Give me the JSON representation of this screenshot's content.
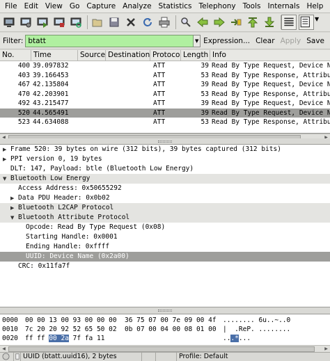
{
  "menubar": [
    "File",
    "Edit",
    "View",
    "Go",
    "Capture",
    "Analyze",
    "Statistics",
    "Telephony",
    "Tools",
    "Internals",
    "Help"
  ],
  "toolbar_icons": [
    "interface-list-icon",
    "capture-options-icon",
    "start-capture-icon",
    "stop-capture-icon",
    "restart-capture-icon",
    "open-file-icon",
    "save-file-icon",
    "close-file-icon",
    "reload-icon",
    "print-icon",
    "find-packet-icon",
    "go-back-icon",
    "go-forward-icon",
    "go-to-packet-icon",
    "go-first-icon",
    "go-last-icon",
    "colorize-icon",
    "auto-scroll-icon"
  ],
  "filter": {
    "label": "Filter:",
    "value": "btatt",
    "expression": "Expression...",
    "clear": "Clear",
    "apply": "Apply",
    "save": "Save"
  },
  "columns": [
    "No.",
    "Time",
    "Source",
    "Destination",
    "Protocol",
    "Length",
    "Info"
  ],
  "packets": [
    {
      "no": "400",
      "time": "39.097832",
      "source": "",
      "destination": "",
      "protocol": "ATT",
      "length": "39",
      "info": "Read By Type Request, Device Nam"
    },
    {
      "no": "403",
      "time": "39.166453",
      "source": "",
      "destination": "",
      "protocol": "ATT",
      "length": "53",
      "info": "Read By Type Response, Attribute"
    },
    {
      "no": "467",
      "time": "42.135804",
      "source": "",
      "destination": "",
      "protocol": "ATT",
      "length": "39",
      "info": "Read By Type Request, Device Nam"
    },
    {
      "no": "470",
      "time": "42.203901",
      "source": "",
      "destination": "",
      "protocol": "ATT",
      "length": "53",
      "info": "Read By Type Response, Attribute"
    },
    {
      "no": "492",
      "time": "43.215477",
      "source": "",
      "destination": "",
      "protocol": "ATT",
      "length": "39",
      "info": "Read By Type Request, Device Nam"
    },
    {
      "no": "520",
      "time": "44.565491",
      "source": "",
      "destination": "",
      "protocol": "ATT",
      "length": "39",
      "info": "Read By Type Request, Device Nam"
    },
    {
      "no": "523",
      "time": "44.634088",
      "source": "",
      "destination": "",
      "protocol": "ATT",
      "length": "53",
      "info": "Read By Type Response, Attribute"
    }
  ],
  "details": [
    {
      "text": "Frame 520: 39 bytes on wire (312 bits), 39 bytes captured (312 bits)",
      "tri": "collapsed",
      "indent": 0,
      "style": "plain"
    },
    {
      "text": "PPI version 0, 19 bytes",
      "tri": "collapsed",
      "indent": 0,
      "style": "plain"
    },
    {
      "text": "DLT: 147, Payload: btle (Bluetooth Low Energy)",
      "tri": "none",
      "indent": 0,
      "style": "plain"
    },
    {
      "text": "Bluetooth Low Energy",
      "tri": "expanded",
      "indent": 0,
      "style": "shade"
    },
    {
      "text": "Access Address: 0x50655292",
      "tri": "none",
      "indent": 1,
      "style": "plain"
    },
    {
      "text": "Data PDU Header: 0x0b02",
      "tri": "collapsed",
      "indent": 1,
      "style": "plain"
    },
    {
      "text": "Bluetooth L2CAP Protocol",
      "tri": "collapsed",
      "indent": 1,
      "style": "shade"
    },
    {
      "text": "Bluetooth Attribute Protocol",
      "tri": "expanded",
      "indent": 1,
      "style": "shade"
    },
    {
      "text": "Opcode: Read By Type Request (0x08)",
      "tri": "none",
      "indent": 2,
      "style": "plain"
    },
    {
      "text": "Starting Handle: 0x0001",
      "tri": "none",
      "indent": 2,
      "style": "plain"
    },
    {
      "text": "Ending Handle: 0xffff",
      "tri": "none",
      "indent": 2,
      "style": "plain"
    },
    {
      "text": "UUID: Device Name (0x2a00)",
      "tri": "none",
      "indent": 2,
      "style": "sel"
    },
    {
      "text": "CRC: 0x11fa7f",
      "tri": "none",
      "indent": 1,
      "style": "plain"
    }
  ],
  "bytes": [
    {
      "offset": "0000",
      "hex_before": "00 00 13 00 93 00 00 00  36 75 07 00 7e 09 00 4f",
      "hex_sel": "",
      "hex_after": "",
      "ascii_before": "........ 6u..~..0",
      "ascii_sel": "",
      "ascii_after": ""
    },
    {
      "offset": "0010",
      "hex_before": "7c 20 20 92 52 65 50 02  0b 07 00 04 00 08 01 00",
      "hex_sel": "",
      "hex_after": "",
      "ascii_before": "|  .ReP. ........",
      "ascii_sel": "",
      "ascii_after": ""
    },
    {
      "offset": "0020",
      "hex_before": "ff ff ",
      "hex_sel": "00 2a",
      "hex_after": " 7f fa 11",
      "ascii_before": "..",
      "ascii_sel": ".*",
      "ascii_after": "..."
    }
  ],
  "status": {
    "field": "UUID (btatt.uuid16), 2 bytes",
    "profile": "Profile: Default"
  }
}
